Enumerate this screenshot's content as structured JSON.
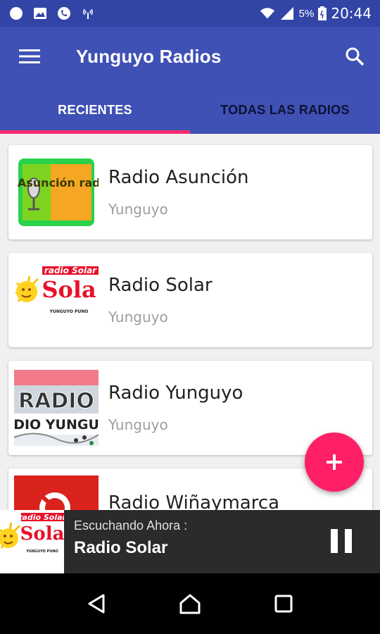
{
  "status_bar": {
    "time": "20:44",
    "battery": "5%",
    "icons": [
      "message-icon",
      "image-icon",
      "phone-icon",
      "hotspot-icon",
      "wifi-icon",
      "signal-icon",
      "battery-icon"
    ]
  },
  "app_bar": {
    "title": "Yunguyo Radios",
    "tabs": [
      {
        "label": "RECIENTES",
        "active": true
      },
      {
        "label": "TODAS LAS RADIOS",
        "active": false
      }
    ]
  },
  "stations": [
    {
      "name": "Radio Asunción",
      "location": "Yunguyo",
      "logo_text": "Asunción radio"
    },
    {
      "name": "Radio Solar",
      "location": "Yunguyo",
      "logo_text": "radio Solar",
      "logo_caption": "YUNGUYO PUNO"
    },
    {
      "name": "Radio Yunguyo",
      "location": "Yunguyo",
      "logo_text": "RADIO YUNGUYO"
    },
    {
      "name": "Radio Wiñaymarca",
      "location": "",
      "logo_text": ""
    }
  ],
  "now_playing": {
    "label": "Escuchando Ahora :",
    "station": "Radio Solar",
    "logo_text": "radio Solar",
    "logo_caption": "YUNGUYO PUNO"
  },
  "colors": {
    "primary": "#3f51b5",
    "primary_dark": "#3245a6",
    "accent": "#ff2d6f",
    "player_bg": "#2b2b2b"
  }
}
